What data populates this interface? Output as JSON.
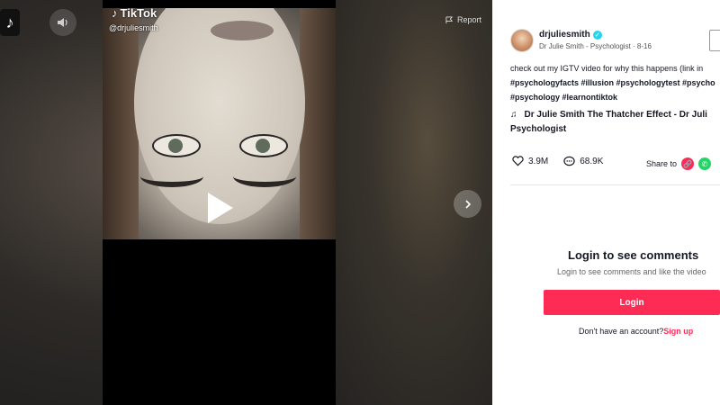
{
  "player": {
    "watermark": "TikTok",
    "watermark_user": "@drjuliesmith",
    "report_label": "Report"
  },
  "author": {
    "username": "drjuliesmith",
    "subline": "Dr Julie Smith - Psychologist · 8-16"
  },
  "caption": {
    "line1": "check out my IGTV video for why this happens (link in",
    "line2": "#psychologyfacts #illusion #psychologytest #psycho",
    "line3": "#psychology #learnontiktok"
  },
  "music": {
    "line1": "Dr Julie Smith The Thatcher Effect - Dr Juli",
    "line2": "Psychologist"
  },
  "stats": {
    "likes": "3.9M",
    "comments": "68.9K",
    "share_label": "Share to"
  },
  "comments_login": {
    "title": "Login to see comments",
    "subtitle": "Login to see comments and like the video",
    "button": "Login",
    "no_account": "Don't have an account?",
    "signup": "Sign up"
  },
  "colors": {
    "brand": "#fe2c55",
    "verified": "#20d5ec",
    "whatsapp": "#25d366"
  },
  "icons": [
    "tiktok-logo-icon",
    "sound-icon",
    "flag-icon",
    "chevron-right-icon",
    "play-icon",
    "verified-icon",
    "music-note-icon",
    "heart-icon",
    "comment-icon",
    "link-icon",
    "whatsapp-icon"
  ]
}
